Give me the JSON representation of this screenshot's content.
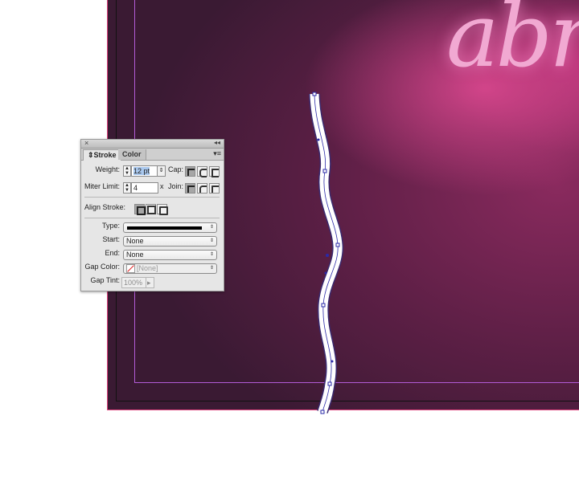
{
  "artwork": {
    "neon_text": "abri",
    "bleed_color": "#e0457f",
    "margin_color": "#b25bd6",
    "path_color": "#ffffff",
    "anchor_color": "#2a2aa8"
  },
  "stroke_panel": {
    "tabs": [
      {
        "label": "Stroke",
        "active": true
      },
      {
        "label": "Color",
        "active": false
      }
    ],
    "weight": {
      "label": "Weight:",
      "value": "12 pt"
    },
    "cap": {
      "label": "Cap:",
      "options": [
        "butt-cap",
        "round-cap",
        "projecting-cap"
      ],
      "selected": "butt-cap"
    },
    "miter_limit": {
      "label": "Miter Limit:",
      "value": "4",
      "unit": "x"
    },
    "join": {
      "label": "Join:",
      "options": [
        "miter-join",
        "round-join",
        "bevel-join"
      ],
      "selected": "miter-join"
    },
    "align_stroke": {
      "label": "Align Stroke:",
      "options": [
        "align-center",
        "align-inside",
        "align-outside"
      ],
      "selected": "align-center"
    },
    "type": {
      "label": "Type:",
      "value": "solid"
    },
    "start": {
      "label": "Start:",
      "value": "None"
    },
    "end": {
      "label": "End:",
      "value": "None"
    },
    "gap_color": {
      "label": "Gap Color:",
      "value": "[None]"
    },
    "gap_tint": {
      "label": "Gap Tint:",
      "value": "100%"
    }
  }
}
